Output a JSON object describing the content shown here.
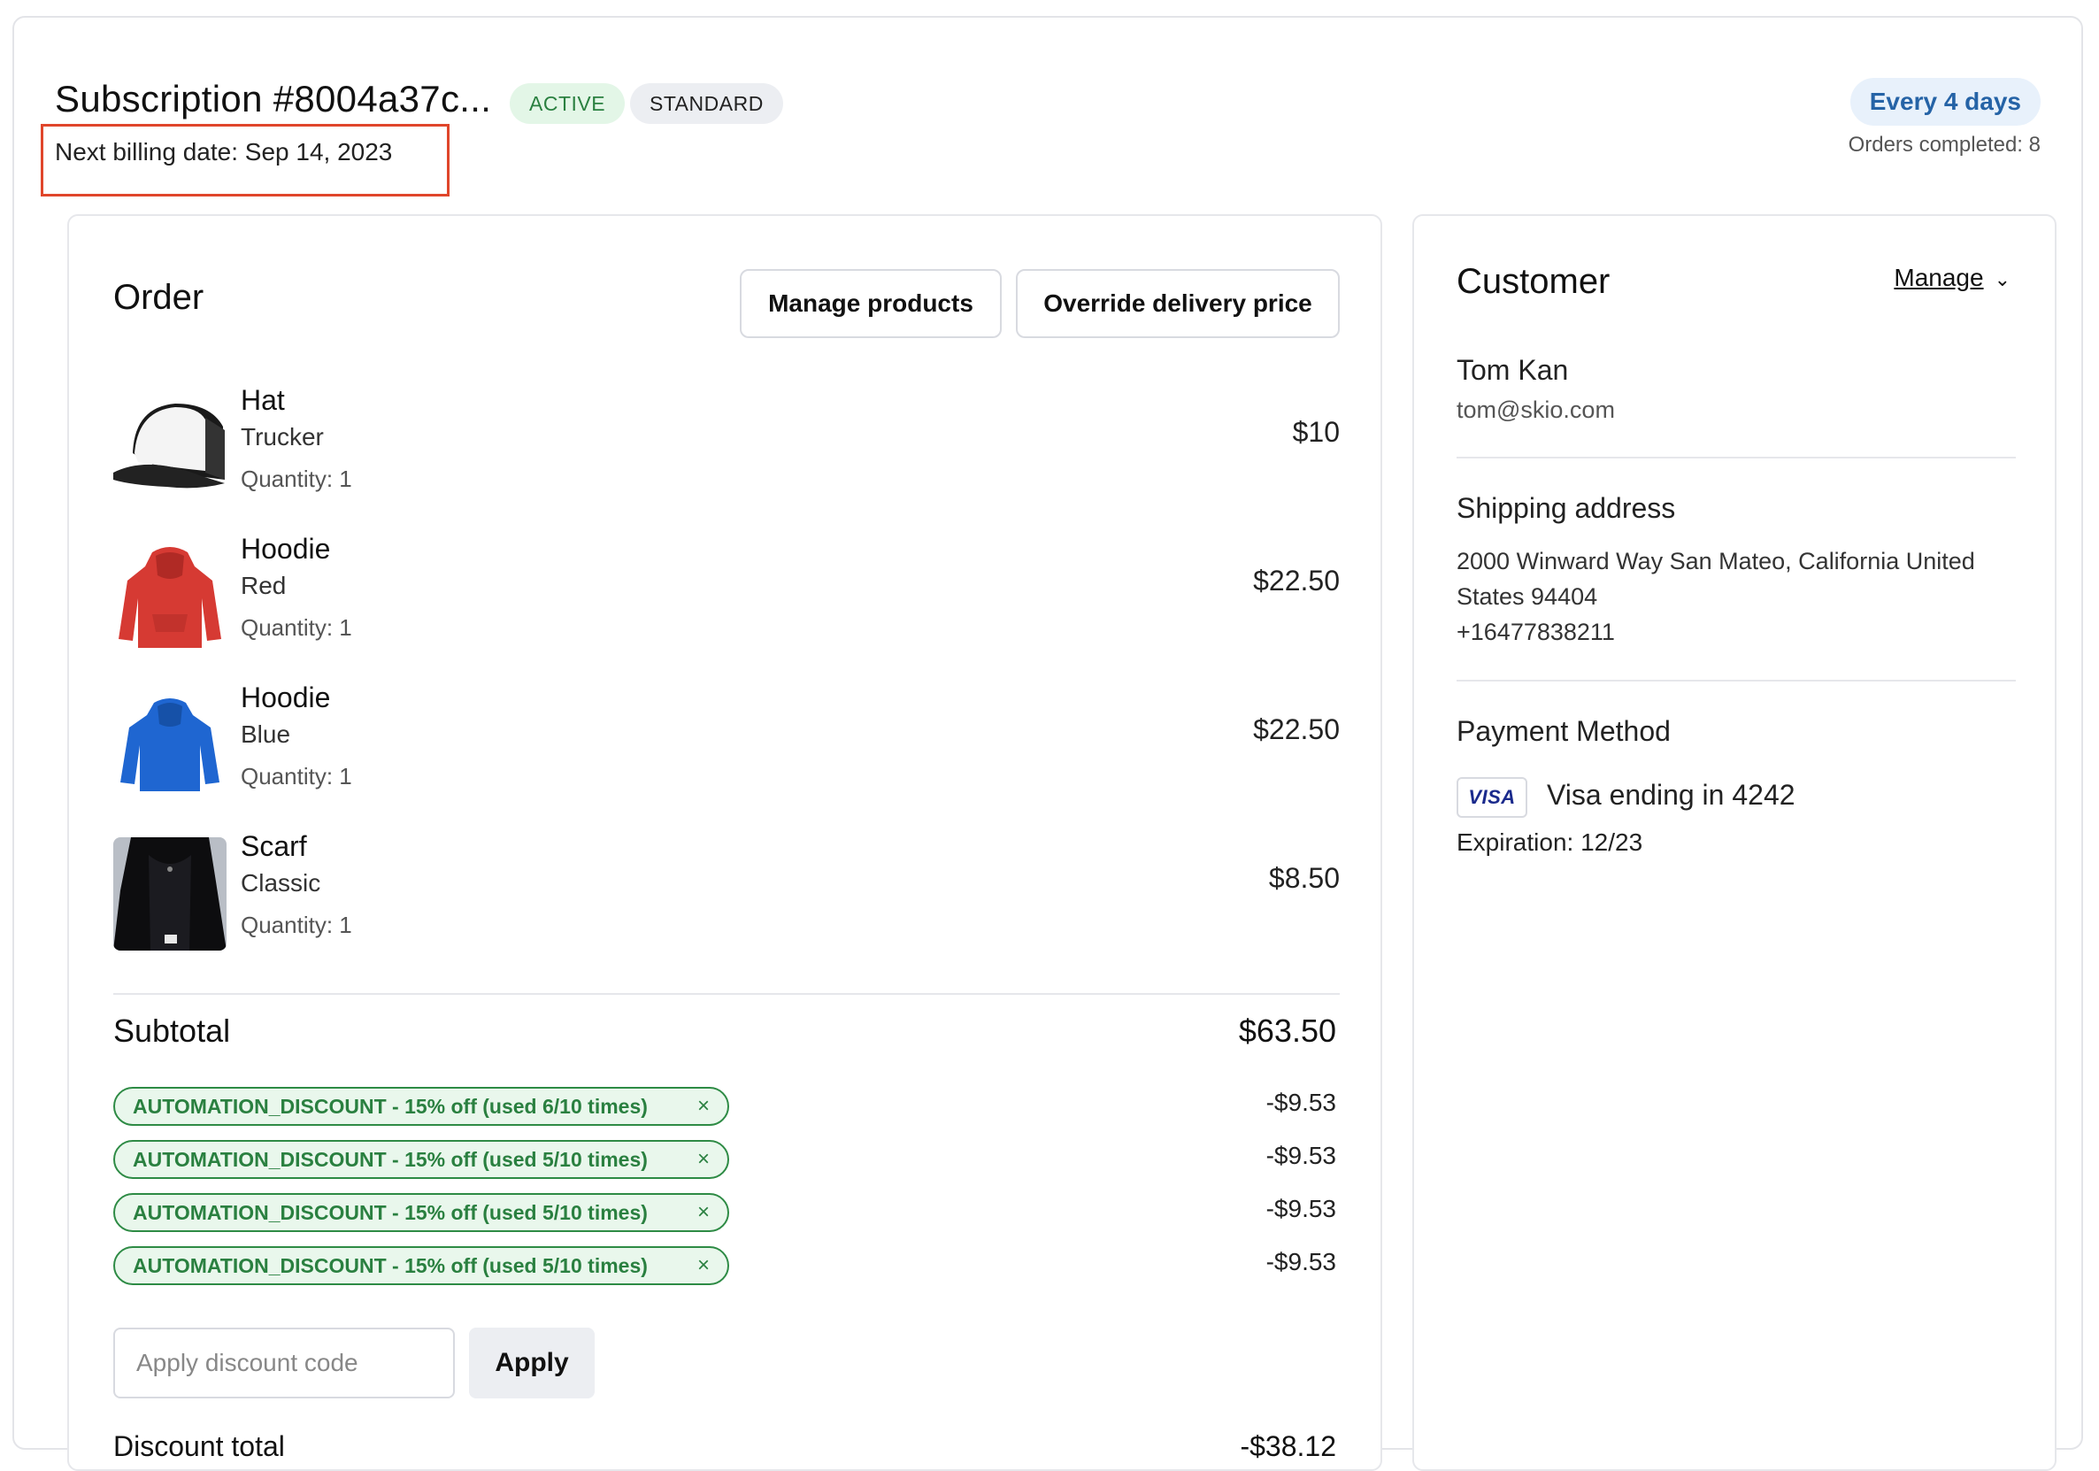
{
  "header": {
    "subscription_title": "Subscription #8004a37c...",
    "status_badge": "ACTIVE",
    "plan_badge": "STANDARD",
    "next_billing": "Next billing date: Sep 14, 2023",
    "frequency": "Every 4 days",
    "orders_completed": "Orders completed: 8"
  },
  "order": {
    "title": "Order",
    "manage_products_label": "Manage products",
    "override_delivery_label": "Override delivery price",
    "products": [
      {
        "name": "Hat",
        "variant": "Trucker",
        "quantity": "Quantity: 1",
        "price": "$10",
        "image": "hat-image"
      },
      {
        "name": "Hoodie",
        "variant": "Red",
        "quantity": "Quantity: 1",
        "price": "$22.50",
        "image": "red-hoodie-image"
      },
      {
        "name": "Hoodie",
        "variant": "Blue",
        "quantity": "Quantity: 1",
        "price": "$22.50",
        "image": "blue-hoodie-image"
      },
      {
        "name": "Scarf",
        "variant": "Classic",
        "quantity": "Quantity: 1",
        "price": "$8.50",
        "image": "scarf-image"
      }
    ],
    "subtotal_label": "Subtotal",
    "subtotal_value": "$63.50",
    "discounts": [
      {
        "label": "AUTOMATION_DISCOUNT - 15% off (used 6/10 times)",
        "amount": "-$9.53"
      },
      {
        "label": "AUTOMATION_DISCOUNT - 15% off (used 5/10 times)",
        "amount": "-$9.53"
      },
      {
        "label": "AUTOMATION_DISCOUNT - 15% off (used 5/10 times)",
        "amount": "-$9.53"
      },
      {
        "label": "AUTOMATION_DISCOUNT - 15% off (used 5/10 times)",
        "amount": "-$9.53"
      }
    ],
    "discount_remove_glyph": "×",
    "discount_input_placeholder": "Apply discount code",
    "apply_label": "Apply",
    "discount_total_label": "Discount total",
    "discount_total_value": "-$38.12"
  },
  "customer": {
    "title": "Customer",
    "manage_label": "Manage",
    "manage_chevron": "⌄",
    "name": "Tom Kan",
    "email": "tom@skio.com",
    "shipping_heading": "Shipping address",
    "address": "2000 Winward Way San Mateo, California United States 94404",
    "phone": "+16477838211",
    "payment_heading": "Payment Method",
    "card_brand": "VISA",
    "card_text": "Visa ending in 4242",
    "expiration": "Expiration: 12/23"
  },
  "colors": {
    "active_badge_bg": "#e3f6e7",
    "discount_green": "#2a8040",
    "frequency_blue": "#2563a6",
    "highlight_box": "#e0462b"
  }
}
